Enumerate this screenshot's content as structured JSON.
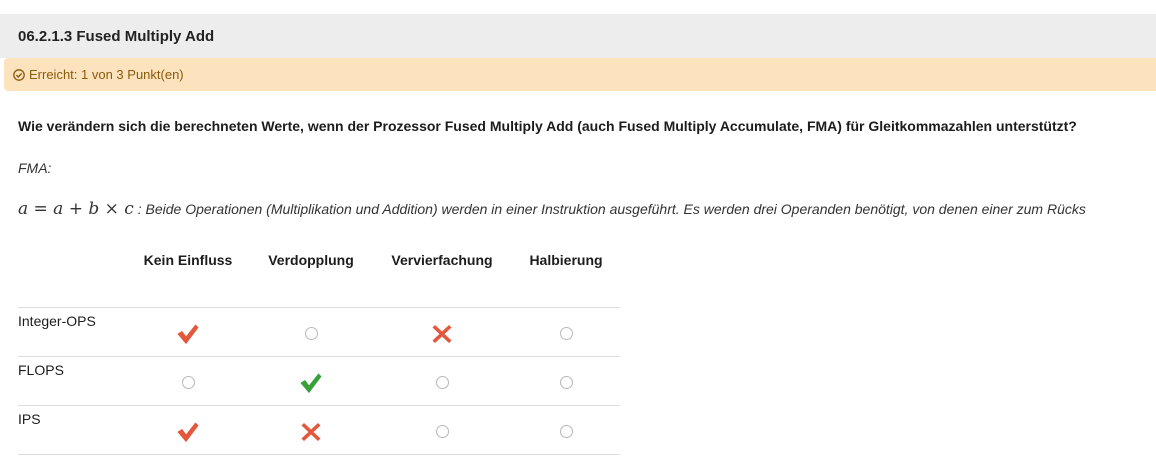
{
  "header": {
    "title": "06.2.1.3 Fused Multiply Add"
  },
  "status": {
    "text": "Erreicht: 1 von 3 Punkt(en)",
    "icon": "check-circle-icon",
    "color": "#8a5a0b",
    "background": "#fde3bd"
  },
  "question": {
    "text": "Wie verändern sich die berechneten Werte, wenn der Prozessor Fused Multiply Add (auch Fused Multiply Accumulate, FMA) für Gleitkommazahlen unterstützt?"
  },
  "fma": {
    "label": "FMA:",
    "formula": "a = a + b × c",
    "description": " : Beide Operationen (Multiplikation und Addition) werden in einer Instruktion ausgeführt. Es werden drei Operanden benötigt, von denen einer zum Rücks"
  },
  "table": {
    "columns": [
      "Kein Einfluss",
      "Verdopplung",
      "Vervierfachung",
      "Halbierung"
    ],
    "rows": [
      {
        "label": "Integer-OPS",
        "cells": [
          "check-red",
          "empty",
          "cross-red",
          "empty"
        ]
      },
      {
        "label": "FLOPS",
        "cells": [
          "empty",
          "check-green",
          "empty",
          "empty"
        ]
      },
      {
        "label": "IPS",
        "cells": [
          "check-red",
          "cross-red",
          "empty",
          "empty"
        ]
      }
    ]
  },
  "colors": {
    "correct": "#3aa13a",
    "incorrect": "#e4573d",
    "incorrect_check": "#e4573d"
  }
}
